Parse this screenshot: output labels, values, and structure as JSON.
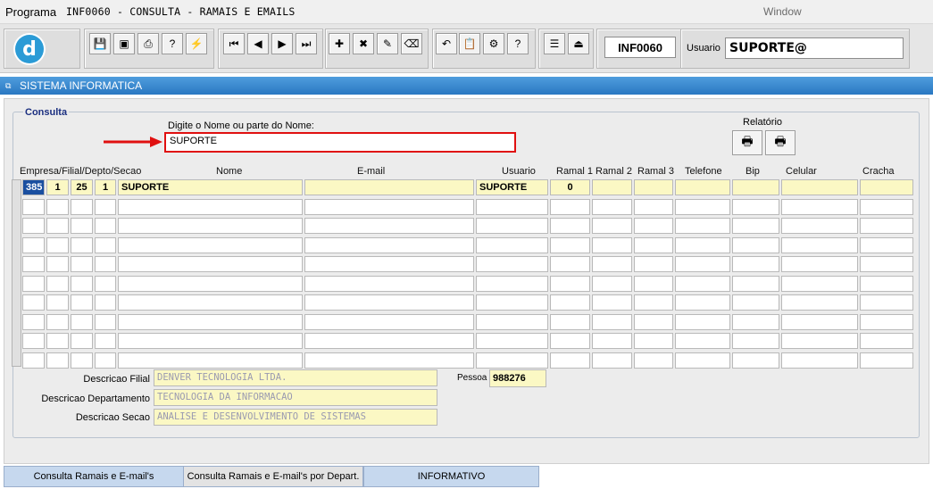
{
  "menubar": {
    "programa_label": "Programa",
    "window_title": "INF0060 - CONSULTA - RAMAIS E EMAILS",
    "window_menu": "Window"
  },
  "toolbar": {
    "form_id": "INF0060",
    "usuario_label": "Usuario",
    "usuario_value": "SUPORTE@",
    "icons": [
      "save-icon",
      "print-preview-icon",
      "print-icon",
      "query-help-icon",
      "execute-query-icon",
      "first-record-icon",
      "previous-record-icon",
      "next-record-icon",
      "last-record-icon",
      "insert-record-icon",
      "delete-record-icon",
      "edit-icon",
      "clear-icon",
      "undo-icon",
      "clipboard-icon",
      "tools-icon",
      "help-icon",
      "menu-icon",
      "exit-icon"
    ]
  },
  "system_bar": {
    "title": "SISTEMA INFORMATICA"
  },
  "consulta": {
    "legend": "Consulta",
    "search_label": "Digite o Nome ou parte do Nome:",
    "search_value": "SUPORTE",
    "relatorio_label": "Relatório"
  },
  "grid": {
    "headers": {
      "empresa": "Empresa/Filial/Depto/Secao",
      "nome": "Nome",
      "email": "E-mail",
      "usuario": "Usuario",
      "ramal1": "Ramal 1",
      "ramal2": "Ramal 2",
      "ramal3": "Ramal 3",
      "telefone": "Telefone",
      "bip": "Bip",
      "celular": "Celular",
      "cracha": "Cracha"
    },
    "row1": {
      "empresa": "385",
      "filial": "1",
      "depto": "25",
      "secao": "1",
      "nome": "SUPORTE",
      "email": "",
      "usuario": "SUPORTE",
      "ramal1": "0",
      "ramal2": "",
      "ramal3": "",
      "telefone": "",
      "bip": "",
      "celular": "",
      "cracha": ""
    }
  },
  "details": {
    "filial_label": "Descricao Filial",
    "filial_value": "DENVER TECNOLOGIA LTDA.",
    "depto_label": "Descricao Departamento",
    "depto_value": "TECNOLOGIA DA INFORMACAO",
    "secao_label": "Descricao Secao",
    "secao_value": "ANALISE E DESENVOLVIMENTO DE SISTEMAS",
    "pessoa_label": "Pessoa",
    "pessoa_value": "988276"
  },
  "tabs": {
    "tab1": "Consulta Ramais e E-mail's",
    "tab2": "Consulta Ramais e E-mail's por Depart.",
    "tab3": "INFORMATIVO"
  },
  "colors": {
    "accent_blue": "#2a78c2",
    "highlight_yellow": "#fbf8c4",
    "arrow_red": "#e01010"
  }
}
